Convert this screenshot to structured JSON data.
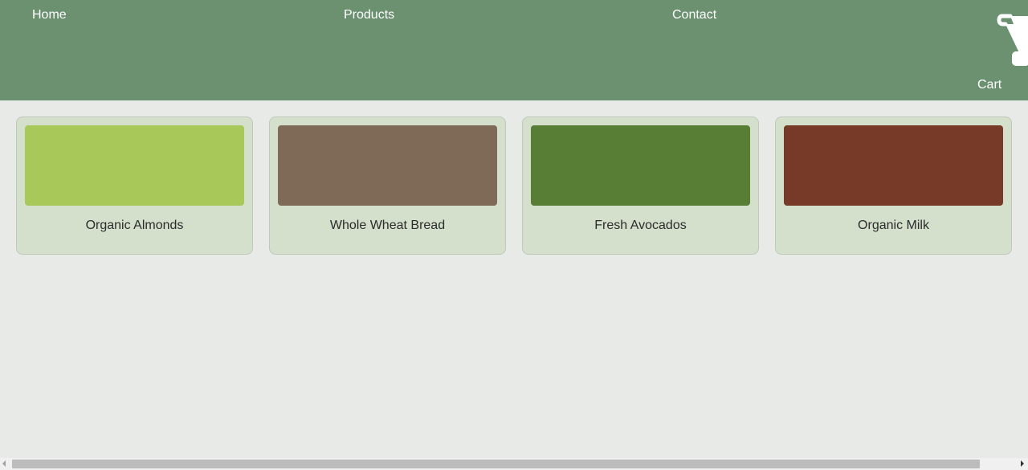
{
  "header": {
    "nav": {
      "home": "Home",
      "products": "Products",
      "contact": "Contact"
    },
    "cart": {
      "label": "Cart",
      "icon": "shopping-cart-icon"
    }
  },
  "products": [
    {
      "name": "Organic Almonds",
      "color": "#a8c85a"
    },
    {
      "name": "Whole Wheat Bread",
      "color": "#7f6a57"
    },
    {
      "name": "Fresh Avocados",
      "color": "#587d35"
    },
    {
      "name": "Organic Milk",
      "color": "#773a28"
    }
  ],
  "colors": {
    "header_bg": "#6b9171",
    "page_bg": "#e8eae8",
    "card_bg": "#d4dfcc"
  }
}
